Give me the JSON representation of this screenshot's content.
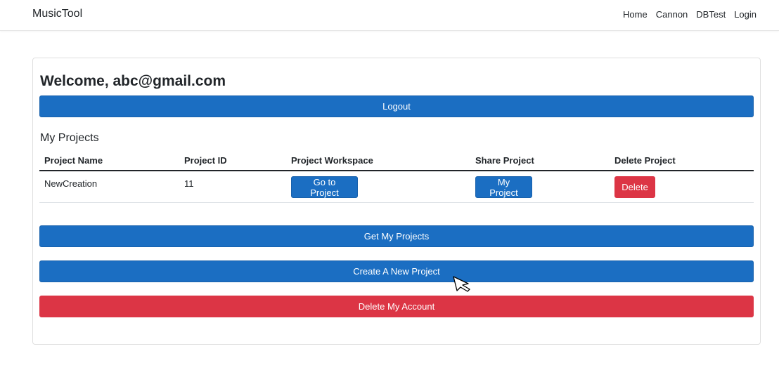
{
  "navbar": {
    "brand": "MusicTool",
    "links": [
      "Home",
      "Cannon",
      "DBTest",
      "Login"
    ]
  },
  "main": {
    "welcome": "Welcome, abc@gmail.com",
    "logout_label": "Logout",
    "projects_title": "My Projects",
    "table": {
      "headers": [
        "Project Name",
        "Project ID",
        "Project Workspace",
        "Share Project",
        "Delete Project"
      ],
      "rows": [
        {
          "name": "NewCreation",
          "id": "11",
          "workspace_button": "Go to Project",
          "share_button": "My Project",
          "delete_button": "Delete"
        }
      ]
    },
    "get_projects_label": "Get My Projects",
    "create_project_label": "Create A New Project",
    "delete_account_label": "Delete My Account"
  },
  "colors": {
    "primary": "#1b6ec2",
    "danger": "#dc3545"
  }
}
